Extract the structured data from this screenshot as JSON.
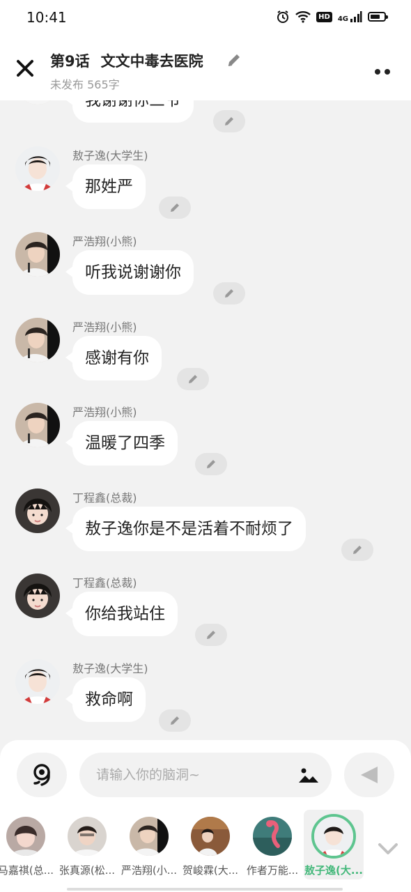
{
  "status_bar": {
    "time": "10:41",
    "hd": "HD",
    "network": "4G"
  },
  "header": {
    "title_episode": "第9话",
    "title_text": "文文中毒去医院",
    "subtitle": "未发布 565字"
  },
  "messages": [
    {
      "sender": "",
      "text": "我谢谢你三爷",
      "avatar": "person-b"
    },
    {
      "sender": "敖子逸(大学生)",
      "text": "那姓严",
      "avatar": "person-a"
    },
    {
      "sender": "严浩翔(小熊)",
      "text": "听我说谢谢你",
      "avatar": "person-b"
    },
    {
      "sender": "严浩翔(小熊)",
      "text": "感谢有你",
      "avatar": "person-b"
    },
    {
      "sender": "严浩翔(小熊)",
      "text": "温暖了四季",
      "avatar": "person-b"
    },
    {
      "sender": "丁程鑫(总裁)",
      "text": "敖子逸你是不是活着不耐烦了",
      "avatar": "person-c"
    },
    {
      "sender": "丁程鑫(总裁)",
      "text": "你给我站住",
      "avatar": "person-c"
    },
    {
      "sender": "敖子逸(大学生)",
      "text": "救命啊",
      "avatar": "person-a"
    }
  ],
  "input": {
    "placeholder": "请输入你的脑洞~"
  },
  "roles": [
    {
      "label": "马嘉祺(总...",
      "selected": false
    },
    {
      "label": "张真源(松...",
      "selected": false
    },
    {
      "label": "严浩翔(小...",
      "selected": false
    },
    {
      "label": "贺峻霖(大...",
      "selected": false
    },
    {
      "label": "作者万能...",
      "selected": false
    },
    {
      "label": "敖子逸(大...",
      "selected": true
    }
  ],
  "colors": {
    "accent": "#5ec58f",
    "background": "#f2f2f2",
    "bubble": "#ffffff"
  },
  "icons": {
    "close": "close-icon",
    "edit": "pencil-icon",
    "more": "more-icon",
    "voice": "voice-icon",
    "image": "image-icon",
    "send": "send-icon",
    "collapse": "chevron-down-icon"
  }
}
